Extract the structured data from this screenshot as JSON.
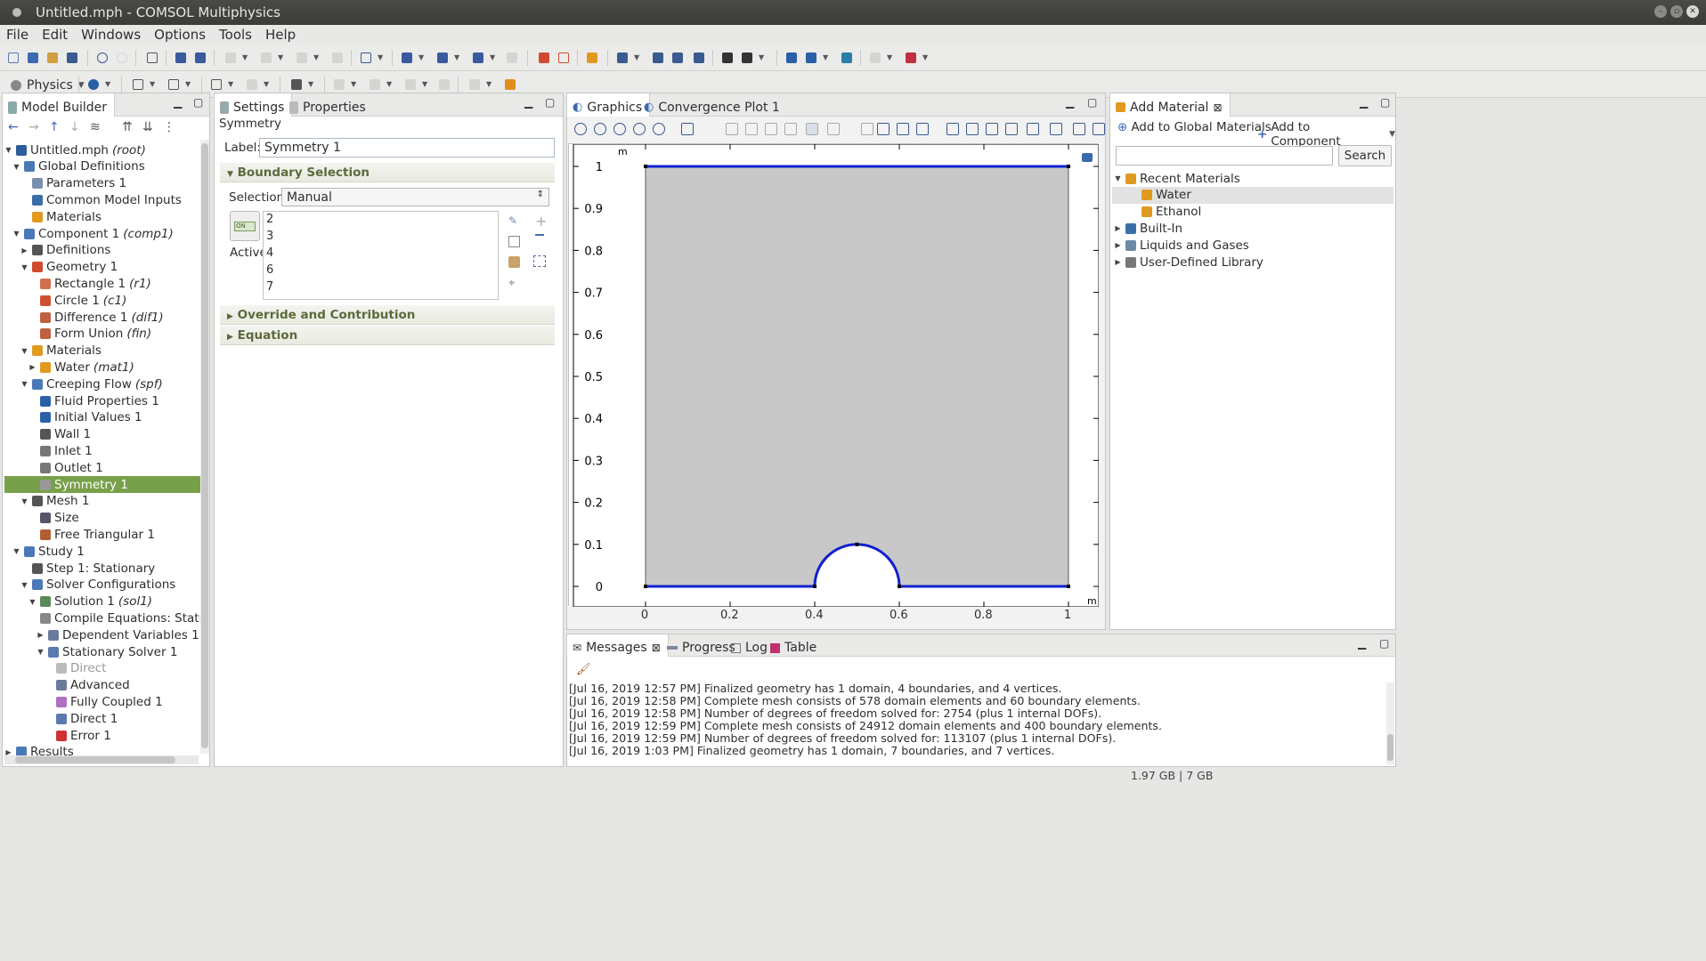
{
  "window": {
    "title": "Untitled.mph - COMSOL Multiphysics"
  },
  "menu": [
    "File",
    "Edit",
    "Windows",
    "Options",
    "Tools",
    "Help"
  ],
  "toolbar2": {
    "physics_label": "Physics"
  },
  "model_builder": {
    "tab_label": "Model Builder",
    "tree": [
      {
        "label": "Untitled.mph",
        "suffix": "(root)",
        "level": 0,
        "tw": "down",
        "color": "#2e5d9c"
      },
      {
        "label": "Global Definitions",
        "level": 1,
        "tw": "down",
        "color": "#4a79b8"
      },
      {
        "label": "Parameters 1",
        "level": 2,
        "color": "#7a8fb0"
      },
      {
        "label": "Common Model Inputs",
        "level": 2,
        "color": "#3a6ea8"
      },
      {
        "label": "Materials",
        "level": 2,
        "color": "#e09a20"
      },
      {
        "label": "Component 1",
        "suffix": "(comp1)",
        "level": 1,
        "tw": "down",
        "color": "#4a79b8"
      },
      {
        "label": "Definitions",
        "level": 2,
        "tw": "right",
        "color": "#555"
      },
      {
        "label": "Geometry 1",
        "level": 2,
        "tw": "down",
        "color": "#d04a30"
      },
      {
        "label": "Rectangle 1",
        "suffix": "(r1)",
        "level": 3,
        "color": "#d07050"
      },
      {
        "label": "Circle 1",
        "suffix": "(c1)",
        "level": 3,
        "color": "#d05030"
      },
      {
        "label": "Difference 1",
        "suffix": "(dif1)",
        "level": 3,
        "color": "#c06040"
      },
      {
        "label": "Form Union",
        "suffix": "(fin)",
        "level": 3,
        "color": "#c06040"
      },
      {
        "label": "Materials",
        "level": 2,
        "tw": "down",
        "color": "#e09a20"
      },
      {
        "label": "Water",
        "suffix": "(mat1)",
        "level": 3,
        "tw": "right",
        "color": "#e09a20"
      },
      {
        "label": "Creeping Flow",
        "suffix": "(spf)",
        "level": 2,
        "tw": "down",
        "color": "#4a79b8"
      },
      {
        "label": "Fluid Properties 1",
        "level": 3,
        "color": "#2a5fa8"
      },
      {
        "label": "Initial Values 1",
        "level": 3,
        "color": "#2a5fa8"
      },
      {
        "label": "Wall 1",
        "level": 3,
        "color": "#555"
      },
      {
        "label": "Inlet 1",
        "level": 3,
        "color": "#777"
      },
      {
        "label": "Outlet 1",
        "level": 3,
        "color": "#777"
      },
      {
        "label": "Symmetry 1",
        "level": 3,
        "color": "#999",
        "selected": true
      },
      {
        "label": "Mesh 1",
        "level": 2,
        "tw": "down",
        "color": "#555"
      },
      {
        "label": "Size",
        "level": 3,
        "color": "#556"
      },
      {
        "label": "Free Triangular 1",
        "level": 3,
        "color": "#b06030"
      },
      {
        "label": "Study 1",
        "level": 1,
        "tw": "down",
        "color": "#4a79b8"
      },
      {
        "label": "Step 1: Stationary",
        "level": 2,
        "color": "#555"
      },
      {
        "label": "Solver Configurations",
        "level": 2,
        "tw": "down",
        "color": "#4a79b8"
      },
      {
        "label": "Solution 1",
        "suffix": "(sol1)",
        "level": 3,
        "tw": "down",
        "color": "#5a8a5a"
      },
      {
        "label": "Compile Equations: Stationar",
        "level": 4,
        "color": "#888"
      },
      {
        "label": "Dependent Variables 1",
        "level": 4,
        "tw": "right",
        "color": "#6a7a9a"
      },
      {
        "label": "Stationary Solver 1",
        "level": 4,
        "tw": "down",
        "color": "#5a7ab0"
      },
      {
        "label": "Direct",
        "level": 5,
        "color": "#bbb",
        "disabled": true
      },
      {
        "label": "Advanced",
        "level": 5,
        "color": "#6a7a9a"
      },
      {
        "label": "Fully Coupled 1",
        "level": 5,
        "color": "#b070c0"
      },
      {
        "label": "Direct 1",
        "level": 5,
        "color": "#5a7ab0"
      },
      {
        "label": "Error 1",
        "level": 5,
        "color": "#d03030"
      },
      {
        "label": "Results",
        "level": 0,
        "tw": "right",
        "color": "#4a79b8"
      }
    ]
  },
  "settings": {
    "tab_label": "Settings",
    "properties_tab": "Properties",
    "heading": "Symmetry",
    "label_caption": "Label:",
    "label_value": "Symmetry 1",
    "boundary_section": "Boundary Selection",
    "selection_caption": "Selection:",
    "selection_value": "Manual",
    "active_label": "Active",
    "active_badge": "ON",
    "boundaries": [
      "2",
      "3",
      "4",
      "6",
      "7"
    ],
    "override_section": "Override and Contribution",
    "equation_section": "Equation"
  },
  "graphics": {
    "tab_label": "Graphics",
    "convergence_tab": "Convergence Plot 1",
    "unit_label": "m",
    "x_ticks": [
      "0",
      "0.2",
      "0.4",
      "0.6",
      "0.8",
      "1"
    ],
    "y_ticks": [
      "0",
      "0.1",
      "0.2",
      "0.3",
      "0.4",
      "0.5",
      "0.6",
      "0.7",
      "0.8",
      "0.9",
      "1"
    ],
    "domain_color": "#c8c8c8",
    "boundary_color": "#1020d0"
  },
  "add_material": {
    "tab_label": "Add Material",
    "add_global": "Add to Global Materials",
    "add_component": "Add to Component",
    "search_button": "Search",
    "tree": [
      {
        "label": "Recent Materials",
        "level": 0,
        "tw": "down",
        "color": "#e09a20"
      },
      {
        "label": "Water",
        "level": 1,
        "color": "#e09a20",
        "selected": true
      },
      {
        "label": "Ethanol",
        "level": 1,
        "color": "#e09a20"
      },
      {
        "label": "Built-In",
        "level": 0,
        "tw": "right",
        "color": "#3a6ea8"
      },
      {
        "label": "Liquids and Gases",
        "level": 0,
        "tw": "right",
        "color": "#6a8aa8"
      },
      {
        "label": "User-Defined Library",
        "level": 0,
        "tw": "right",
        "color": "#777"
      }
    ]
  },
  "messages": {
    "tabs": [
      "Messages",
      "Progress",
      "Log",
      "Table"
    ],
    "lines": [
      "[Jul 16, 2019 12:57 PM] Finalized geometry has 1 domain, 4 boundaries, and 4 vertices.",
      "[Jul 16, 2019 12:58 PM] Complete mesh consists of 578 domain elements and 60 boundary elements.",
      "[Jul 16, 2019 12:58 PM] Number of degrees of freedom solved for: 2754 (plus 1 internal DOFs).",
      "[Jul 16, 2019 12:59 PM] Complete mesh consists of 24912 domain elements and 400 boundary elements.",
      "[Jul 16, 2019 12:59 PM] Number of degrees of freedom solved for: 113107 (plus 1 internal DOFs).",
      "[Jul 16, 2019 1:03 PM] Finalized geometry has 1 domain, 7 boundaries, and 7 vertices."
    ]
  },
  "status": {
    "memory": "1.97 GB | 7 GB"
  }
}
